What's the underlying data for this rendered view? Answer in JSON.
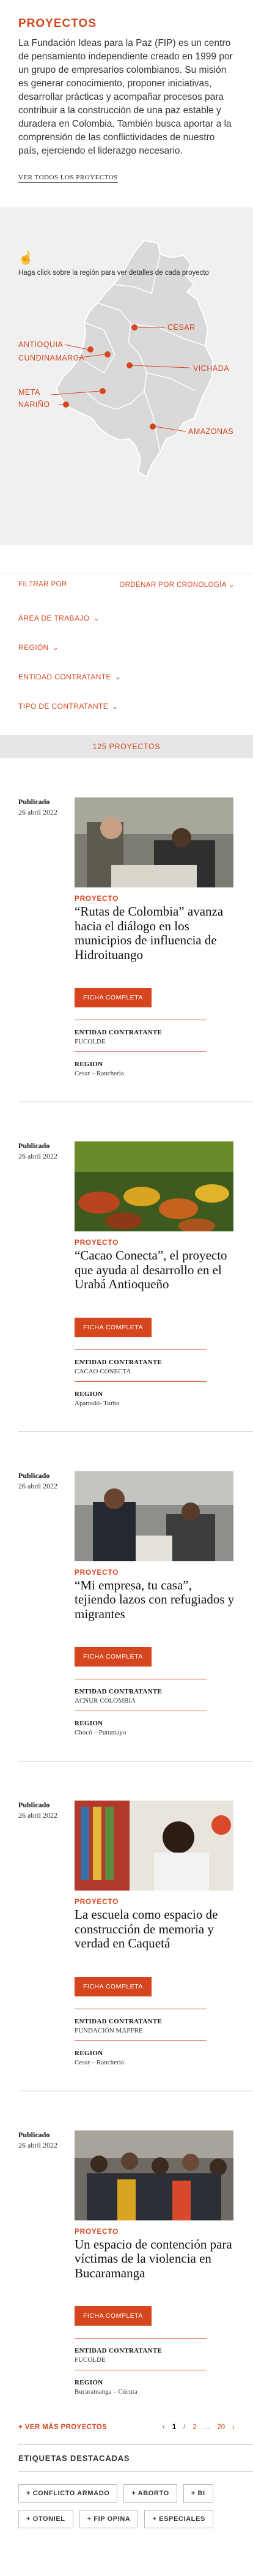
{
  "intro": {
    "heading": "PROYECTOS",
    "text": "La Fundación Ideas para la Paz (FIP) es un centro de pensamiento independiente creado en 1999 por un grupo de empresarios colombianos. Su misión es generar conocimiento, proponer iniciativas, desarrollar prácticas y acompañar procesos para contribuir a la construcción de una paz estable y duradera en Colombia. También busca aportar a la comprensión de las conflictividades de nuestro país, ejerciendo el liderazgo necesario.",
    "all_link": "VER TODOS LOS PROYECTOS"
  },
  "map": {
    "hint": "Haga click sobre la región para ver detalles de cada proyecto",
    "regions": {
      "cesar": "CESAR",
      "antioquia": "ANTIOQUIA",
      "cundinamarca": "CUNDINAMARCA",
      "vichada": "VICHADA",
      "meta": "META",
      "narino": "NARIÑO",
      "amazonas": "AMAZONAS"
    }
  },
  "filters": {
    "filter_by": "FILTRAR POR",
    "sort_by": "ORDENAR POR CRONOLOGÍA",
    "facets": [
      "ÁREA DE TRABAJO",
      "REGIÓN",
      "ENTIDAD CONTRATANTE",
      "TIPO DE CONTRATANTE"
    ],
    "count": "125 PROYECTOS"
  },
  "labels": {
    "published": "Publicado",
    "kicker": "PROYECTO",
    "button": "FICHA COMPLETA",
    "entity": "ENTIDAD CONTRATANTE",
    "region": "REGION"
  },
  "projects": [
    {
      "date": "26 abril 2022",
      "title": "“Rutas de Colombia” avanza hacia el diálogo en los municipios de influencia de Hidroituango",
      "entity": "FUCOLDE",
      "region": "Cesar – Rancheria"
    },
    {
      "date": "26 abril 2022",
      "title": "“Cacao Conecta”, el proyecto que ayuda al desarrollo en el Urabá Antioqueño",
      "entity": "CACAO CONECTA",
      "region": "Apartadó- Turbo"
    },
    {
      "date": "26 abril 2022",
      "title": "“Mi empresa, tu casa”, tejiendo lazos con refugiados y migrantes",
      "entity": "ACNUR COLOMBIA",
      "region": "Chocó – Putumayo"
    },
    {
      "date": "26 abril 2022",
      "title": "La escuela como espacio de construcción de memoria y verdad en Caquetá",
      "entity": "FUNDACIÓN MAPFRE",
      "region": "Cesar – Rancheria"
    },
    {
      "date": "26 abril 2022",
      "title": "Un espacio de contención para víctimas de la violencia en Bucaramanga",
      "entity": "FUCOLDE",
      "region": "Bucaramanga – Cúcuta"
    }
  ],
  "pager": {
    "more": "VER MÁS PROYECTOS",
    "prev": "‹",
    "p1": "1",
    "sep": "/",
    "p2": "2",
    "dots": "...",
    "last": "20",
    "next": "›"
  },
  "tags": {
    "heading": "ETIQUETAS DESTACADAS",
    "row1": [
      "CONFLICTO ARMADO",
      "ABORTO",
      "BI"
    ],
    "row2": [
      "OTONIEL",
      "FIP OPINA",
      "ESPECIALES"
    ]
  },
  "colors": {
    "accent": "#d5451e",
    "map_bg": "#f0f0f0"
  }
}
